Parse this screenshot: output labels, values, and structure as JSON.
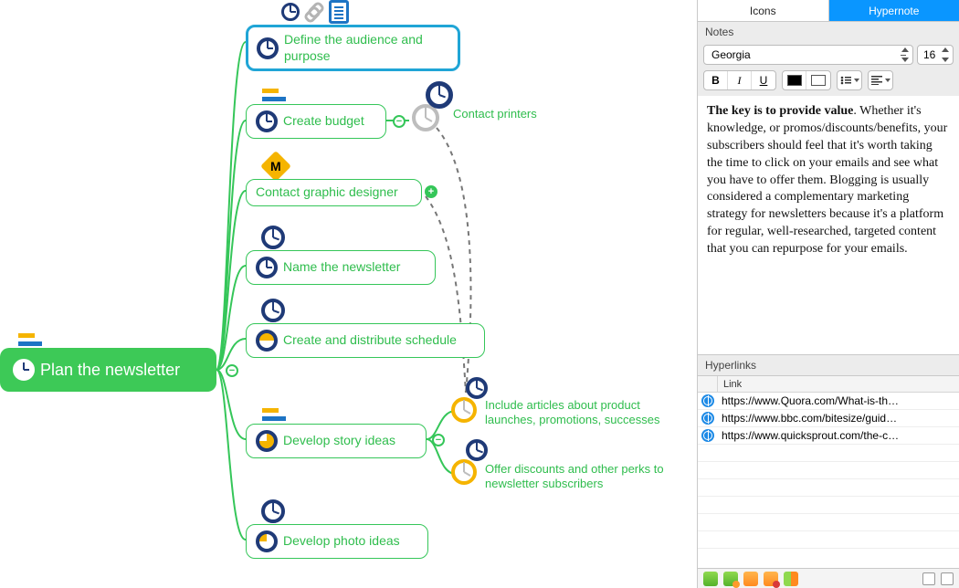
{
  "canvas": {
    "root": {
      "label": "Plan the newsletter"
    },
    "nodes": {
      "define": {
        "label": "Define the audience and purpose"
      },
      "budget": {
        "label": "Create budget"
      },
      "graphic": {
        "label": "Contact graphic designer"
      },
      "name": {
        "label": "Name the newsletter"
      },
      "schedule": {
        "label": "Create and distribute schedule"
      },
      "story": {
        "label": "Develop story ideas"
      },
      "photo": {
        "label": "Develop photo ideas"
      }
    },
    "subnotes": {
      "printers": "Contact printers",
      "launches": "Include articles about product launches, promotions, successes",
      "discounts": "Offer discounts and other perks to newsletter subscribers"
    },
    "marker_m": "M"
  },
  "sidebar": {
    "tabs": {
      "icons": "Icons",
      "hypernote": "Hypernote"
    },
    "notes_header": "Notes",
    "font": "Georgia",
    "font_size": "16",
    "note_bold": "The key is to provide value",
    "note_rest": ". Whether it's knowledge, or promos/discounts/benefits, your subscribers should feel that it's worth taking the time to click on your emails and see what you have to offer them. Blogging is usually considered a complementary marketing strategy for newsletters because it's a platform for regular, well-researched, targeted content that you can repurpose for your emails.",
    "hyperlinks_header": "Hyperlinks",
    "links_col": "Link",
    "links": [
      "https://www.Quora.com/What-is-th…",
      "https://www.bbc.com/bitesize/guid…",
      "https://www.quicksprout.com/the-c…"
    ]
  }
}
